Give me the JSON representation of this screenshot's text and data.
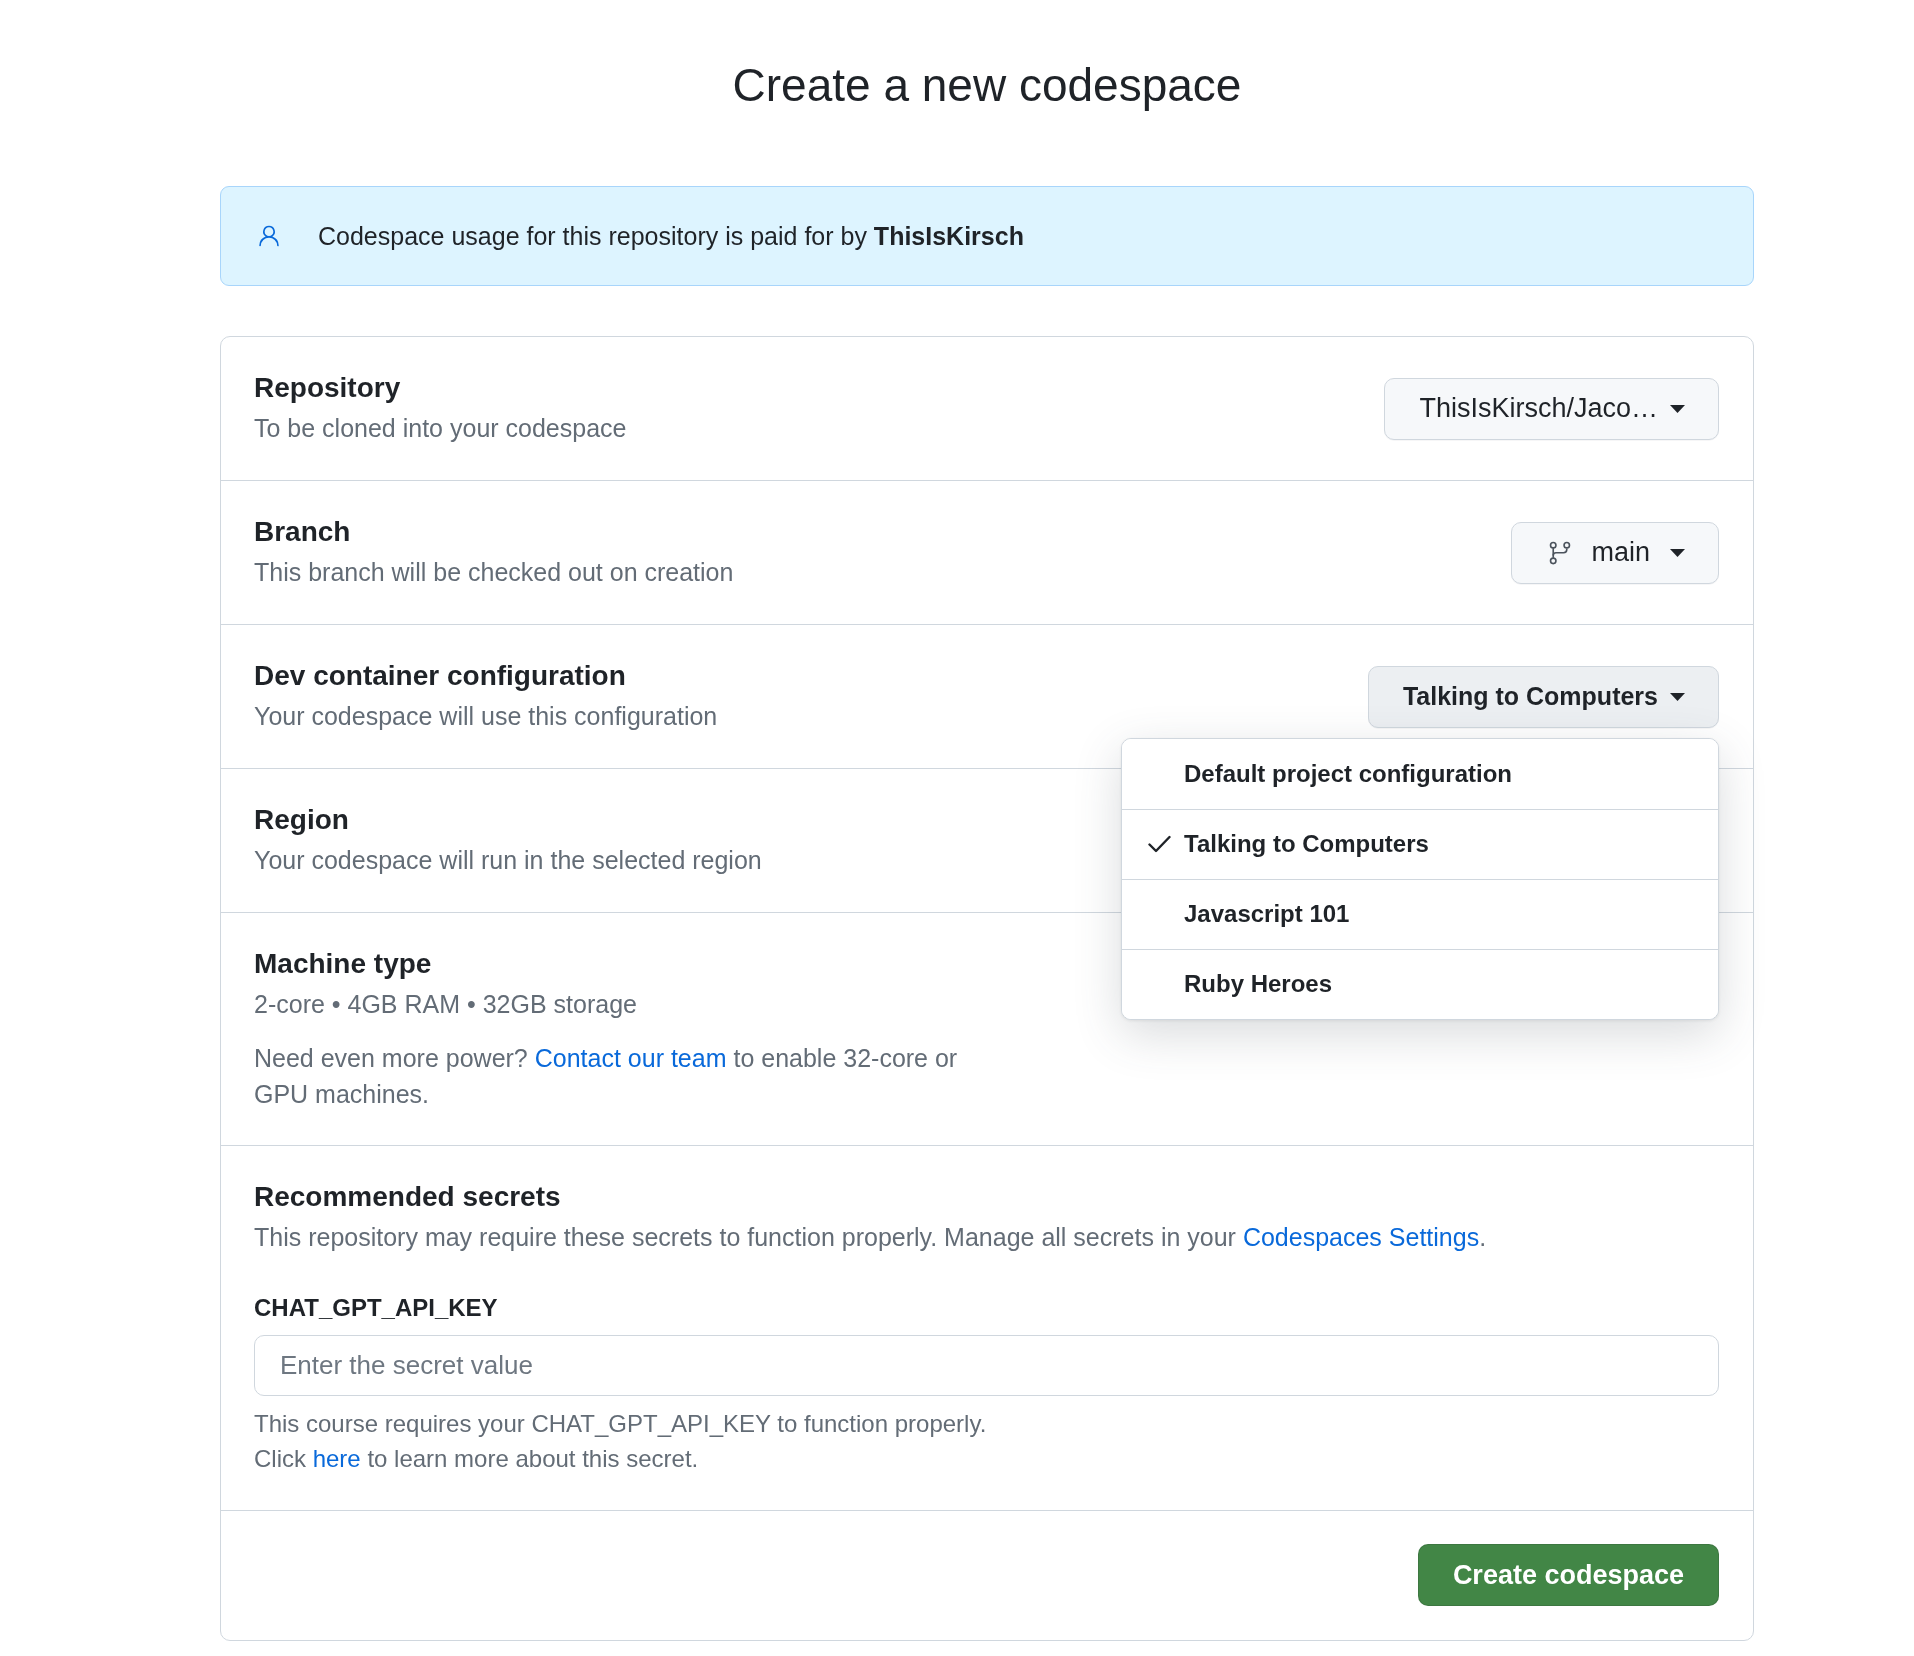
{
  "page": {
    "title": "Create a new codespace"
  },
  "notice": {
    "text": "Codespace usage for this repository is paid for by **ThisIsKirsch**"
  },
  "settings": [
    {
      "title": "Repository",
      "description": "To be cloned into your codespace",
      "control": {
        "kind": "select",
        "label": "ThisIsKirsch/Jaco…",
        "expanded": false
      }
    },
    {
      "title": "Branch",
      "description": "This branch will be checked out on creation",
      "control": {
        "kind": "branch",
        "label": "main",
        "expanded": false
      }
    },
    {
      "title": "Dev container configuration",
      "description": "Your codespace will use this configuration",
      "control": {
        "kind": "select",
        "label": "Talking to Computers",
        "expanded": true,
        "options": [
          {
            "label": "Default project configuration",
            "selected": false
          },
          {
            "label": "Talking to Computers",
            "selected": true
          },
          {
            "label": "Javascript 101",
            "selected": false
          },
          {
            "label": "Ruby Heroes",
            "selected": false
          }
        ]
      }
    },
    {
      "title": "Region",
      "description": "Your codespace will run in the selected region"
    },
    {
      "title": "Machine type",
      "description": "2-core • 4GB RAM • 32GB storage",
      "note": {
        "before": "Need even more power? ",
        "link": "Contact our team",
        "after": " to enable 32-core or GPU machines."
      }
    }
  ],
  "secrets": {
    "title": "Recommended secrets",
    "description": {
      "before": "This repository may require these secrets to function properly. Manage all secrets in your ",
      "link": "Codespaces Settings",
      "after": "."
    },
    "items": [
      {
        "name": "CHAT_GPT_API_KEY",
        "placeholder": "Enter the secret value",
        "help": "This course requires your CHAT_GPT_API_KEY to function properly.",
        "more": {
          "before": "Click ",
          "link": "here",
          "after": " to learn more about this secret."
        }
      }
    ]
  },
  "footer": {
    "button": "Create codespace"
  }
}
